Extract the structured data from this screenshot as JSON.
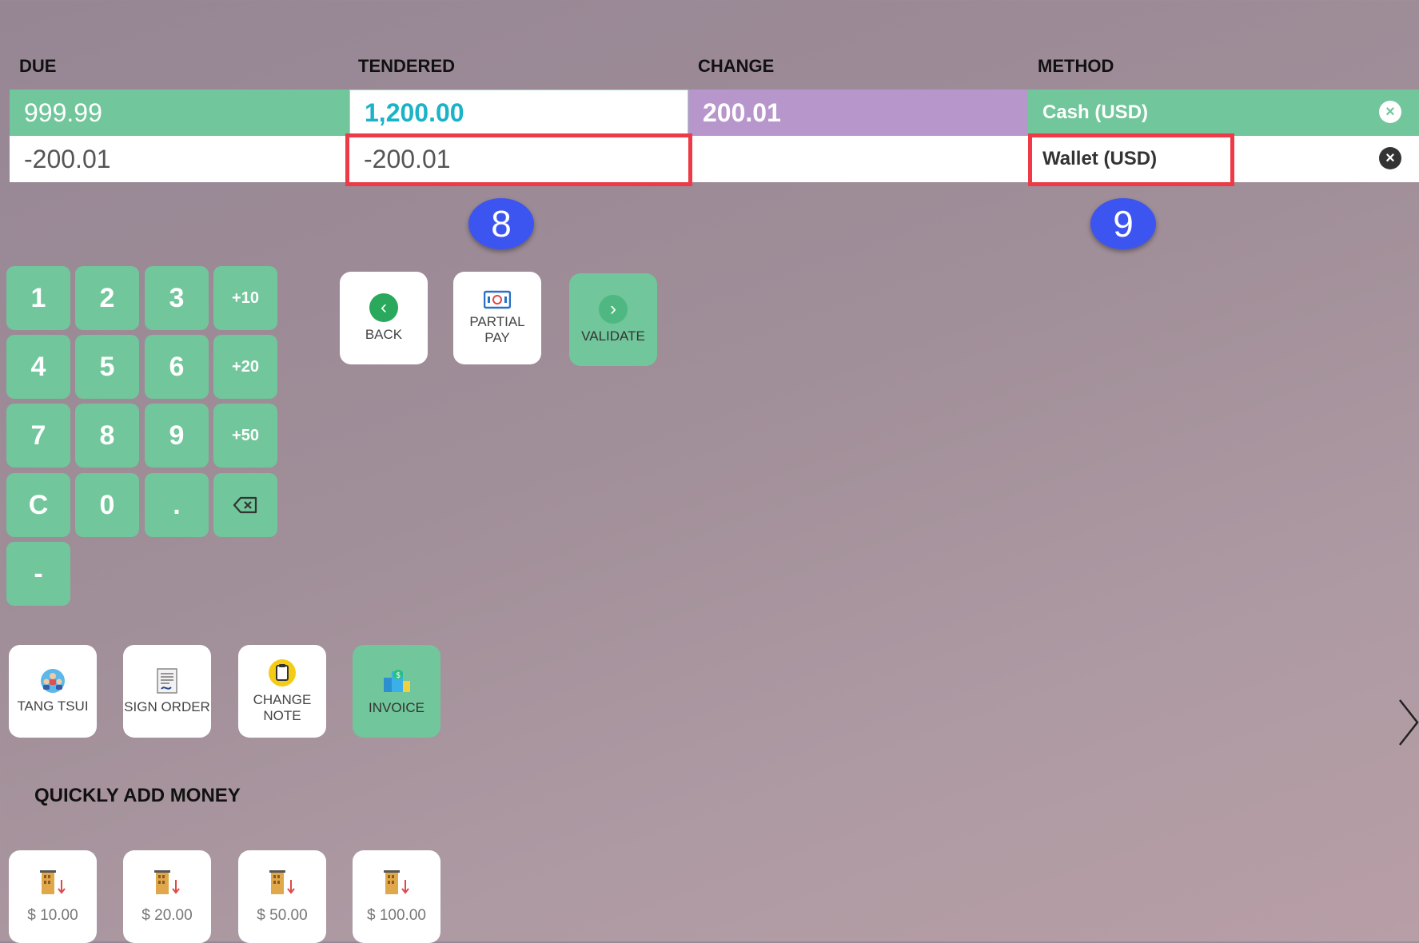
{
  "headers": {
    "due": "DUE",
    "tendered": "TENDERED",
    "change": "CHANGE",
    "method": "METHOD"
  },
  "lines": [
    {
      "due": "999.99",
      "tendered": "1,200.00",
      "change": "200.01",
      "method": "Cash (USD)"
    },
    {
      "due": "-200.01",
      "tendered": "-200.01",
      "change": "",
      "method": "Wallet (USD)"
    }
  ],
  "annotations": {
    "badge_tendered": "8",
    "badge_method": "9"
  },
  "keypad": {
    "k1": "1",
    "k2": "2",
    "k3": "3",
    "p10": "+10",
    "k4": "4",
    "k5": "5",
    "k6": "6",
    "p20": "+20",
    "k7": "7",
    "k8": "8",
    "k9": "9",
    "p50": "+50",
    "clear": "C",
    "k0": "0",
    "dot": ".",
    "minus": "-"
  },
  "actions": {
    "back": "BACK",
    "partial_pay": "PARTIAL PAY",
    "validate": "VALIDATE"
  },
  "extras": {
    "customer": "TANG TSUI",
    "sign_order": "SIGN ORDER",
    "change_note": "CHANGE NOTE",
    "invoice": "INVOICE"
  },
  "quick_money": {
    "title": "QUICKLY ADD MONEY",
    "amounts": [
      "$ 10.00",
      "$ 20.00",
      "$ 50.00",
      "$ 100.00"
    ]
  },
  "colors": {
    "green": "#71c69b",
    "purple": "#b797cb",
    "teal_text": "#1bb3c8",
    "highlight": "#ee3a46",
    "badge": "#3d55f0"
  }
}
